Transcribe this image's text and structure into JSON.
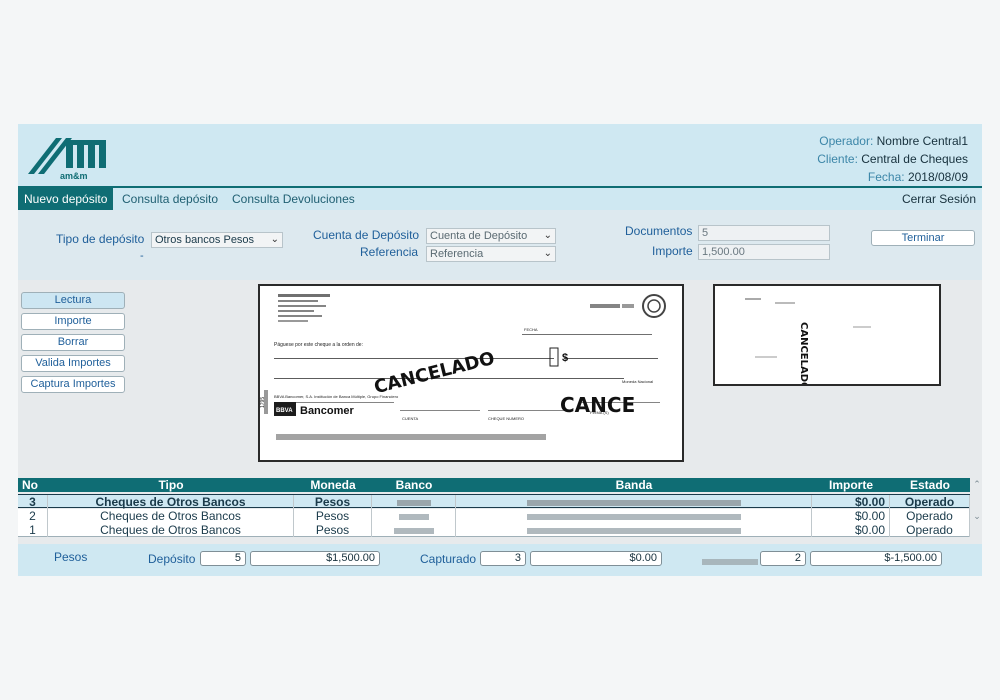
{
  "logo": {
    "text": "am&m"
  },
  "header": {
    "operador_label": "Operador:",
    "operador_value": "Nombre Central1",
    "cliente_label": "Cliente:",
    "cliente_value": "Central de Cheques",
    "fecha_label": "Fecha:",
    "fecha_value": "2018/08/09"
  },
  "nav": {
    "tabs": [
      "Nuevo depósito",
      "Consulta depósito",
      "Consulta Devoluciones"
    ],
    "logout": "Cerrar Sesión"
  },
  "form": {
    "tipo_label": "Tipo de depósito",
    "tipo_value": "Otros bancos Pesos",
    "tipo_dash": "-",
    "cuenta_label": "Cuenta de Depósito",
    "cuenta_value": "Cuenta de Depósito",
    "referencia_label": "Referencia",
    "referencia_value": "Referencia",
    "documentos_label": "Documentos",
    "documentos_value": "5",
    "importe_label": "Importe",
    "importe_value": "1,500.00",
    "terminar": "Terminar"
  },
  "actions": [
    "Lectura",
    "Importe",
    "Borrar",
    "Valida Importes",
    "Captura Importes"
  ],
  "cheque": {
    "payee_line": "Páguese por este cheque a la orden de:",
    "fecha_label": "FECHA",
    "stamp": "CANCELADO",
    "stamp2": "CANCE",
    "currency": "$",
    "moneda": "Moneda Nacional",
    "bank_legal": "BBVA Bancomer, S.A. Institución de Banca Múltiple, Grupo Financiero",
    "bank_badge": "BBVA",
    "bank_name": "Bancomer",
    "cuenta_label": "CUENTA",
    "cheque_num_label": "CHEQUE NUMERO",
    "firma_label": "FIRMA (S)",
    "side_num": "1795"
  },
  "back_image": {
    "stamp": "CANCELADO"
  },
  "table": {
    "headers": [
      "No",
      "Tipo",
      "Moneda",
      "Banco",
      "Banda",
      "Importe",
      "Estado"
    ],
    "rows": [
      {
        "no": "3",
        "tipo": "Cheques de Otros Bancos",
        "moneda": "Pesos",
        "importe": "$0.00",
        "estado": "Operado"
      },
      {
        "no": "2",
        "tipo": "Cheques de Otros Bancos",
        "moneda": "Pesos",
        "importe": "$0.00",
        "estado": "Operado"
      },
      {
        "no": "1",
        "tipo": "Cheques de Otros Bancos",
        "moneda": "Pesos",
        "importe": "$0.00",
        "estado": "Operado"
      }
    ]
  },
  "footer": {
    "moneda": "Pesos",
    "deposito_label": "Depósito",
    "deposito_count": "5",
    "deposito_amount": "$1,500.00",
    "capturado_label": "Capturado",
    "capturado_count": "3",
    "capturado_amount": "$0.00",
    "diferencia_count": "2",
    "diferencia_amount": "$-1,500.00"
  },
  "colors": {
    "accent": "#0f6d74",
    "header_bg": "#cfe8f2",
    "link": "#1f5f9a"
  }
}
